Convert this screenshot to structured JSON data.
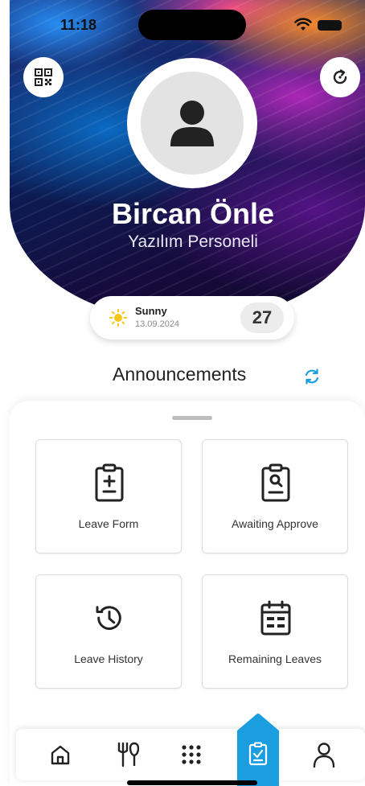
{
  "status_bar": {
    "time": "11:18"
  },
  "profile": {
    "name": "Bircan Önle",
    "role": "Yazılım Personeli"
  },
  "weather": {
    "condition": "Sunny",
    "date": "13.09.2024",
    "temperature": "27"
  },
  "announcements": {
    "title": "Announcements"
  },
  "menu": {
    "tiles": [
      {
        "label": "Leave Form",
        "icon": "document-plus-icon"
      },
      {
        "label": "Awaiting Approve",
        "icon": "document-search-icon"
      },
      {
        "label": "Leave History",
        "icon": "history-icon"
      },
      {
        "label": "Remaining Leaves",
        "icon": "calendar-icon"
      }
    ]
  },
  "bottom_nav": {
    "items": [
      "home-icon",
      "restaurant-icon",
      "apps-grid-icon",
      "leave-clipboard-icon",
      "profile-icon"
    ],
    "active_index": 3
  },
  "colors": {
    "accent": "#1a9ee0",
    "active_tab": "#1a9ee0",
    "sun": "#f5c518",
    "text_dark": "#222222"
  }
}
